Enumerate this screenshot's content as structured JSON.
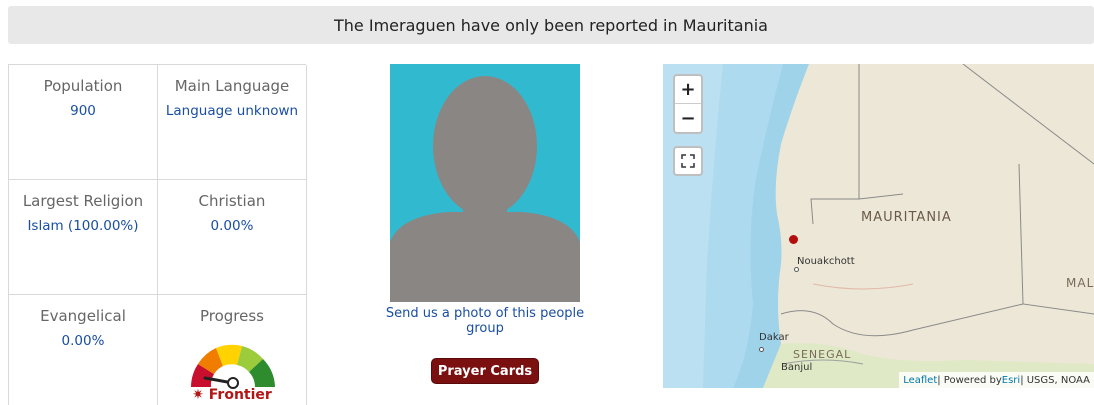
{
  "banner": {
    "text": "The Imeraguen have only been reported in Mauritania"
  },
  "stats": {
    "population": {
      "label": "Population",
      "value": "900"
    },
    "main_language": {
      "label": "Main Language",
      "value": "Language unknown"
    },
    "largest_religion": {
      "label": "Largest Religion",
      "value": "Islam (100.00%)"
    },
    "christian": {
      "label": "Christian",
      "value": "0.00%"
    },
    "evangelical": {
      "label": "Evangelical",
      "value": "0.00%"
    },
    "progress": {
      "label": "Progress",
      "status": "Frontier",
      "icon": "frontier-star-icon",
      "status_color": "#b31515"
    }
  },
  "photo": {
    "link_text": "Send us a photo of this people group",
    "background": "#31b9cf"
  },
  "prayer_cards": {
    "label": "Prayer Cards",
    "color": "#7a1010"
  },
  "map": {
    "zoom_in": "+",
    "zoom_out": "−",
    "labels": {
      "country": "MAURITANIA",
      "country_partial": "MAL",
      "country2": "SENEGAL",
      "city1": "Nouakchott",
      "city2": "Dakar",
      "city3": "Banjul"
    },
    "attribution": {
      "leaflet": "Leaflet",
      "sep1": " | Powered by ",
      "esri": "Esri",
      "rest": " | USGS, NOAA"
    },
    "marker_color": "#b30d0d"
  }
}
